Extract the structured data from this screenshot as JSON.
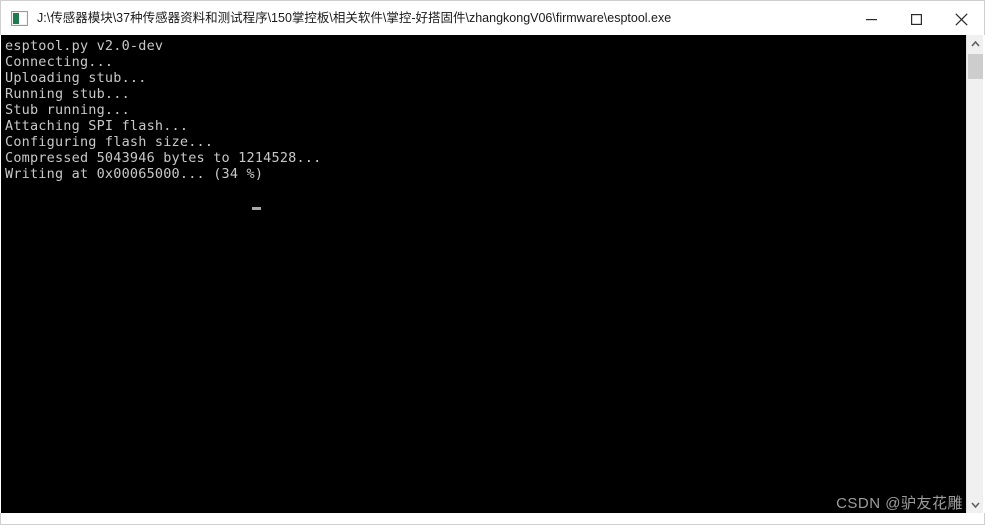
{
  "window": {
    "title": "J:\\传感器模块\\37种传感器资料和测试程序\\150掌控板\\相关软件\\掌控-好搭固件\\zhangkongV06\\firmware\\esptool.exe",
    "icon": "console-window-icon",
    "background_color": "#000000",
    "titlebar_color": "#ffffff"
  },
  "titlebar": {
    "minimize_label": "—",
    "maximize_label": "▢",
    "close_label": "✕"
  },
  "console": {
    "text_color": "#c8c8c8",
    "lines": [
      "esptool.py v2.0-dev",
      "Connecting...",
      "Uploading stub...",
      "Running stub...",
      "Stub running...",
      "Attaching SPI flash...",
      "Configuring flash size...",
      "Compressed 5043946 bytes to 1214528...",
      "Writing at 0x00065000... (34 %)"
    ],
    "full_text": "esptool.py v2.0-dev\nConnecting...\nUploading stub...\nRunning stub...\nStub running...\nAttaching SPI flash...\nConfiguring flash size...\nCompressed 5043946 bytes to 1214528...\nWriting at 0x00065000... (34 %)",
    "progress_percent": "34 %",
    "current_address": "0x00065000",
    "compressed_from_bytes": "5043946",
    "compressed_to_bytes": "1214528",
    "version": "v2.0-dev"
  },
  "scrollbar": {
    "up_arrow": "▲",
    "down_arrow": "▼"
  },
  "watermark": {
    "text": "CSDN @驴友花雕"
  }
}
